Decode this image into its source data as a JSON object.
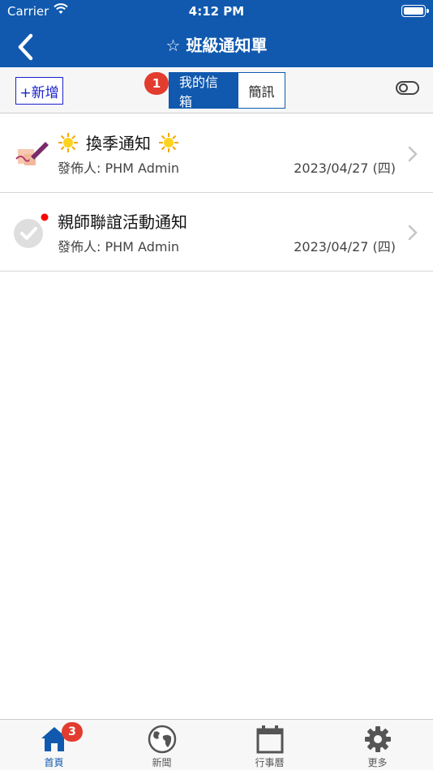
{
  "status_bar": {
    "carrier": "Carrier",
    "time": "4:12 PM"
  },
  "nav": {
    "title": "☆ 班級通知單",
    "back_icon": "chevron-left-icon"
  },
  "toolbar": {
    "add_label": "+新增",
    "tabs": [
      {
        "label": "我的信箱",
        "active": true,
        "badge": "1"
      },
      {
        "label": "簡訊",
        "active": false
      }
    ],
    "toggle_icon": "toggle-icon"
  },
  "notices": [
    {
      "title": "換季通知",
      "sender": "發佈人: PHM Admin",
      "date": "2023/04/27 (四)",
      "icon": "pen-signature-icon",
      "unread": false
    },
    {
      "title": "親師聯誼活動通知",
      "sender": "發佈人: PHM Admin",
      "date": "2023/04/27 (四)",
      "icon": "check-circle-icon",
      "unread": true
    }
  ],
  "tabbar": {
    "items": [
      {
        "label": "首頁",
        "icon": "home-icon",
        "active": true,
        "badge": "3"
      },
      {
        "label": "新聞",
        "icon": "globe-icon",
        "active": false
      },
      {
        "label": "行事曆",
        "icon": "calendar-icon",
        "active": false
      },
      {
        "label": "更多",
        "icon": "gear-icon",
        "active": false
      }
    ]
  },
  "colors": {
    "primary": "#1059ae",
    "badge": "#e23c2f",
    "add_button": "#1b22c9"
  }
}
